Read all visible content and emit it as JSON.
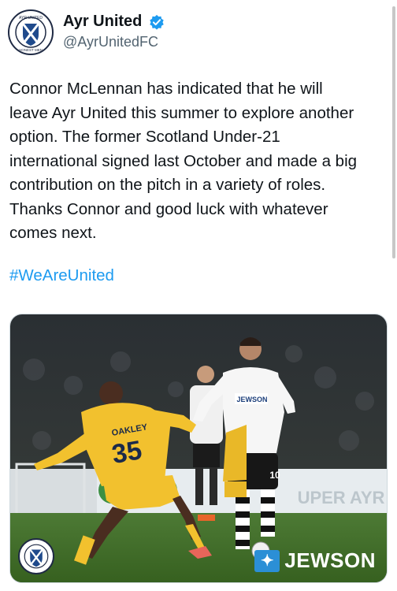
{
  "author": {
    "display_name": "Ayr United",
    "handle": "@AyrUnitedFC",
    "avatar_icon": "club-crest-icon",
    "verified_icon": "verified-badge-icon"
  },
  "tweet": {
    "lines": [
      "Connor McLennan has indicated that he will",
      "leave Ayr United this summer to explore another",
      "option. The former Scotland Under-21",
      "international signed last October and made a big",
      "contribution on the pitch in a variety of roles.",
      "Thanks Connor and good luck with whatever",
      "comes next."
    ],
    "hashtag": "#WeAreUnited"
  },
  "media": {
    "sponsor_name": "JEWSON",
    "player_number": "35",
    "player_name": "OAKLEY",
    "shirt_sponsor": "JEWSON",
    "opponent_number": "10",
    "board_text": "UPER AYR",
    "colors": {
      "yellow_kit": "#f2c12e",
      "white_kit": "#f4f4f4",
      "pitch": "#3f6b2c",
      "link": "#1d9bf0"
    }
  }
}
